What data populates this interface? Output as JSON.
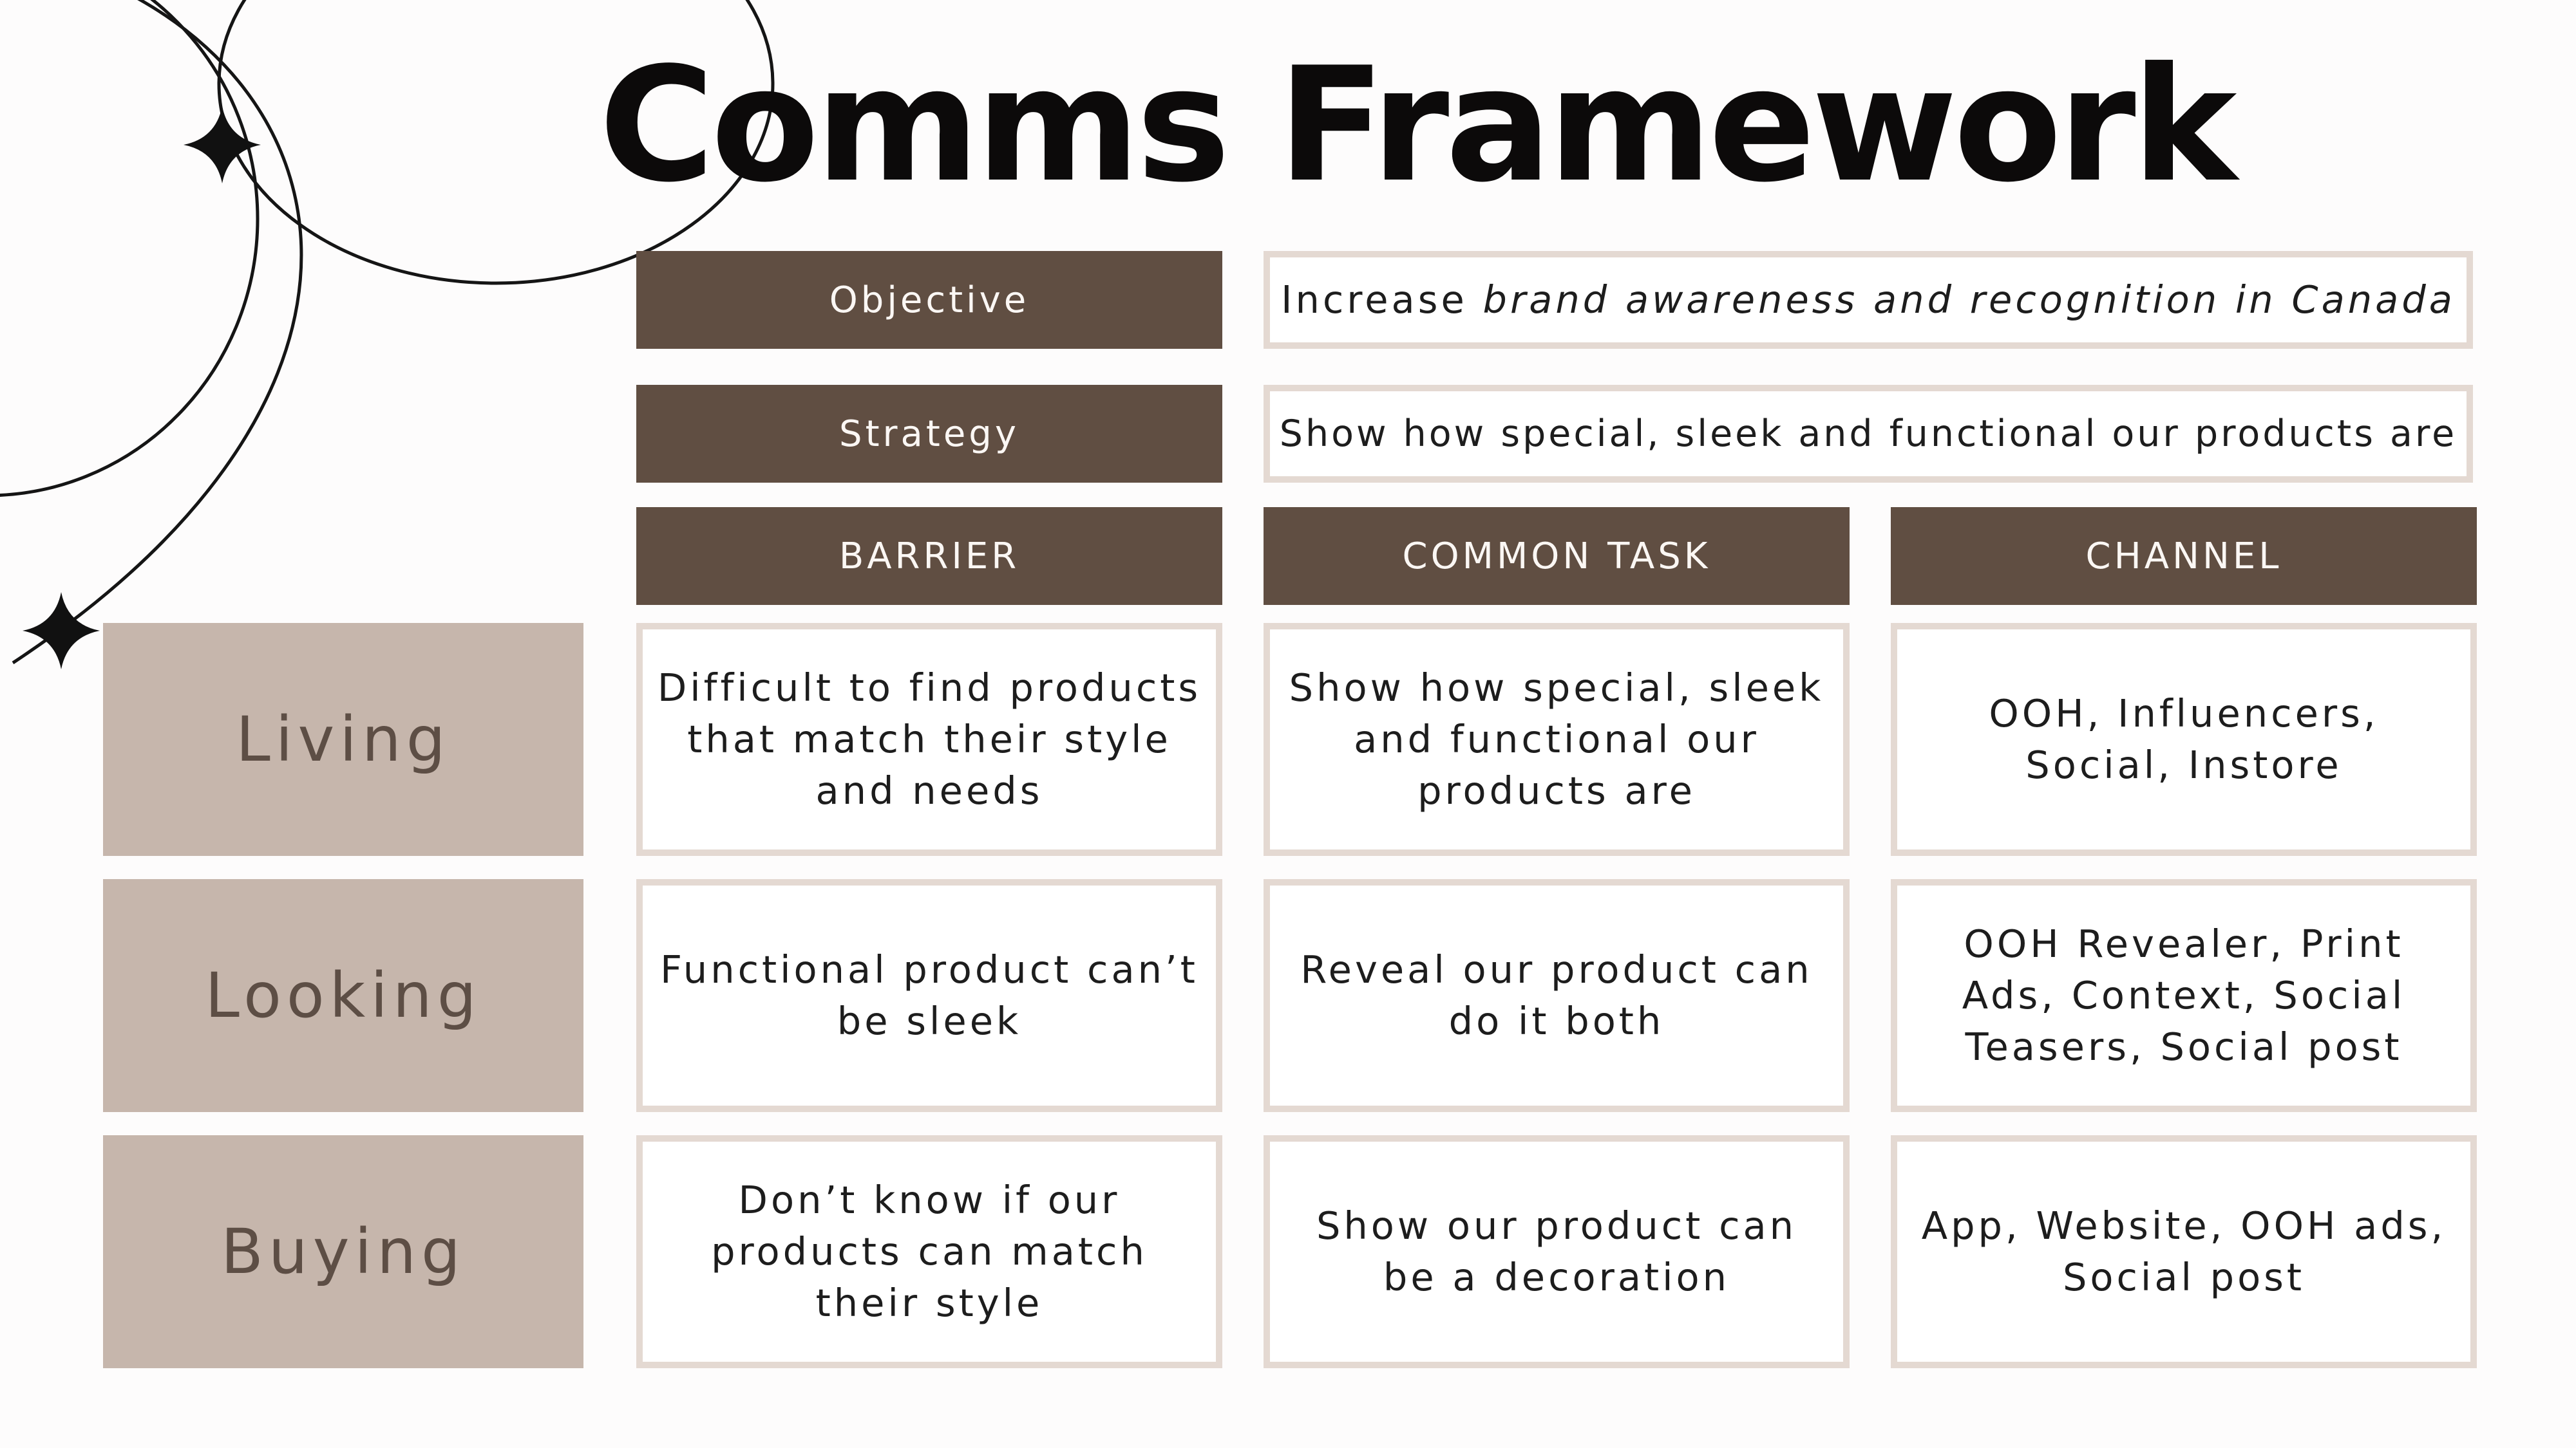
{
  "title": "Comms Framework",
  "objective": {
    "label": "Objective",
    "value_prefix": "Increase ",
    "value_emphasis": "brand awareness and recognition in Canada"
  },
  "strategy": {
    "label": "Strategy",
    "value": "Show how special, sleek and functional our products are"
  },
  "columns": [
    "BARRIER",
    "COMMON TASK",
    "CHANNEL"
  ],
  "rows": [
    {
      "stage": "Living",
      "barrier": "Difficult to find products that match their style and needs",
      "task": "Show how special, sleek and functional our products are",
      "channel": "OOH, Influencers, Social, Instore"
    },
    {
      "stage": "Looking",
      "barrier": "Functional product can’t be sleek",
      "task": "Reveal our product can do it both",
      "channel": "OOH Revealer, Print Ads, Context, Social Teasers, Social post"
    },
    {
      "stage": "Buying",
      "barrier": "Don’t know if our products can match their style",
      "task": "Show our product can be a decoration",
      "channel": "App, Website, OOH ads, Social post"
    }
  ],
  "colors": {
    "header_brown": "#604e42",
    "stage_taupe": "#c6b6ac",
    "box_border": "#e4d9d2",
    "title": "#0c0a0a"
  }
}
